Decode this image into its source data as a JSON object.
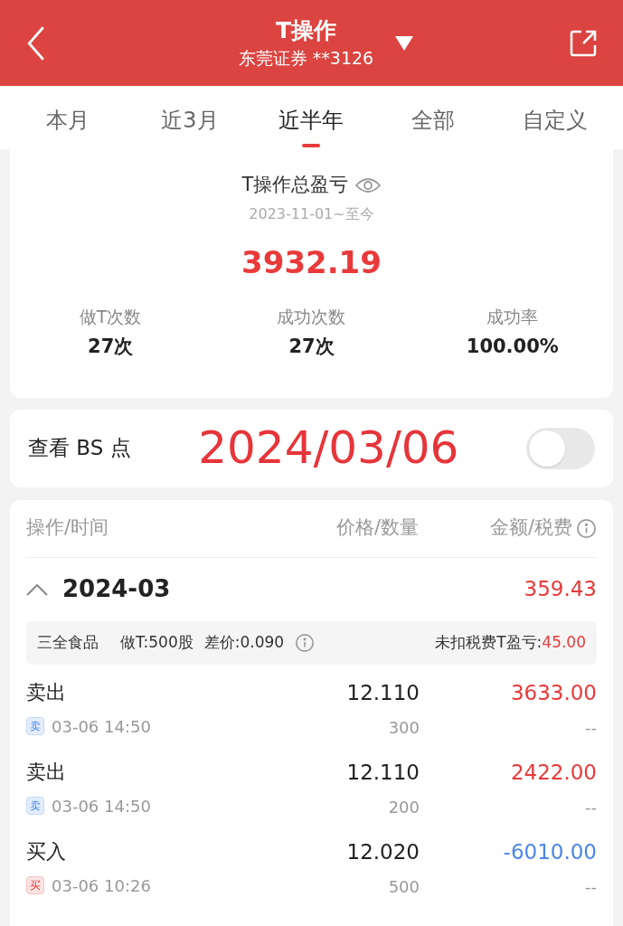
{
  "header": {
    "title": "T操作",
    "subtitle": "东莞证券 **3126"
  },
  "tabs": [
    {
      "label": "本月",
      "selected": false
    },
    {
      "label": "近3月",
      "selected": false
    },
    {
      "label": "近半年",
      "selected": true
    },
    {
      "label": "全部",
      "selected": false
    },
    {
      "label": "自定义",
      "selected": false
    }
  ],
  "summary": {
    "title": "T操作总盈亏",
    "period": "2023-11-01~至今",
    "total": "3932.19",
    "stats": [
      {
        "label": "做T次数",
        "value": "27次"
      },
      {
        "label": "成功次数",
        "value": "27次"
      },
      {
        "label": "成功率",
        "value": "100.00%"
      }
    ]
  },
  "bs_point": {
    "label": "查看 BS 点",
    "date": "2024/03/06",
    "on": false
  },
  "table": {
    "columns": [
      "操作/时间",
      "价格/数量",
      "金额/税费"
    ],
    "group": {
      "month": "2024-03",
      "total": "359.43",
      "expanded": true,
      "stock": {
        "name": "三全食品",
        "volume": "做T:500股",
        "spread": "差价:0.090",
        "profit_label": "未扣税费T盈亏:",
        "profit": "45.00"
      },
      "trades": [
        {
          "kind": "sell",
          "action": "卖出",
          "tag": "卖",
          "time": "03-06 14:50",
          "price": "12.110",
          "qty": "300",
          "amount": "3633.00",
          "fee": "--"
        },
        {
          "kind": "sell",
          "action": "卖出",
          "tag": "卖",
          "time": "03-06 14:50",
          "price": "12.110",
          "qty": "200",
          "amount": "2422.00",
          "fee": "--"
        },
        {
          "kind": "buy",
          "action": "买入",
          "tag": "买",
          "time": "03-06 10:26",
          "price": "12.020",
          "qty": "500",
          "amount": "-6010.00",
          "fee": "--"
        }
      ]
    }
  }
}
